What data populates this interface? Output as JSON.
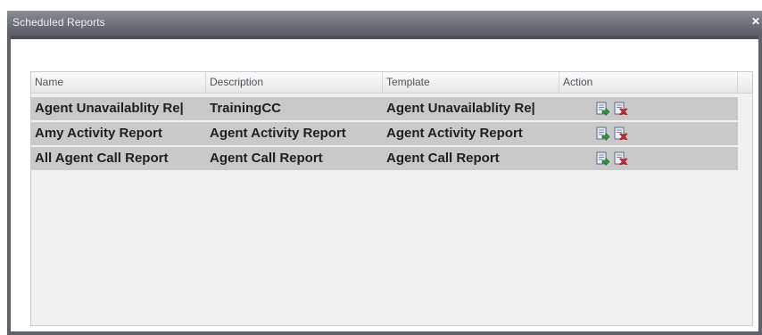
{
  "window": {
    "title": "Scheduled Reports"
  },
  "table": {
    "columns": {
      "name": "Name",
      "description": "Description",
      "template": "Template",
      "action": "Action"
    },
    "rows": [
      {
        "name": "Agent Unavailablity Re|",
        "description": "TrainingCC",
        "template": "Agent Unavailablity Re|"
      },
      {
        "name": "Amy Activity Report",
        "description": "Agent Activity Report",
        "template": "Agent Activity Report"
      },
      {
        "name": "All Agent Call Report",
        "description": "Agent Call Report",
        "template": "Agent Call Report"
      }
    ],
    "actions": [
      "run-report-icon",
      "delete-report-icon"
    ]
  },
  "colors": {
    "titlebar": "#6c7077",
    "row_background": "#c9c9c9",
    "grid_background": "#f1f1f1",
    "run_icon_green": "#2f9a3a",
    "delete_icon_red": "#d42a2a"
  }
}
